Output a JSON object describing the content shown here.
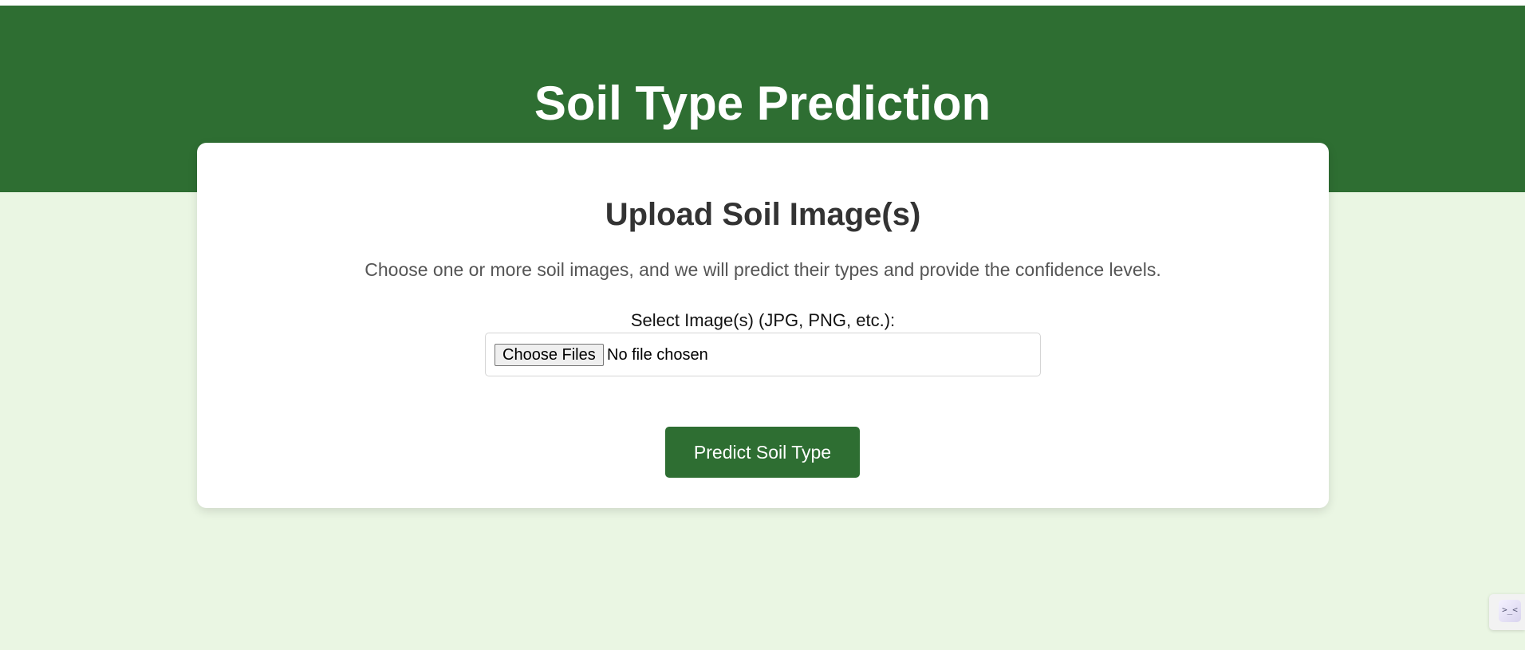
{
  "header": {
    "title": "Soil Type Prediction"
  },
  "upload_card": {
    "heading": "Upload Soil Image(s)",
    "description": "Choose one or more soil images, and we will predict their types and provide the confidence levels.",
    "file_input": {
      "label": "Select Image(s) (JPG, PNG, etc.):",
      "button_label": "Choose Files",
      "status_text": "No file chosen"
    },
    "submit_label": "Predict Soil Type"
  },
  "corner_widget": {
    "glyph": ">_<",
    "icon": "face-emoticon-icon"
  },
  "colors": {
    "header_green": "#2e6e32",
    "page_background": "#eaf6e3",
    "card_background": "#ffffff",
    "button_green": "#2e6e32"
  }
}
